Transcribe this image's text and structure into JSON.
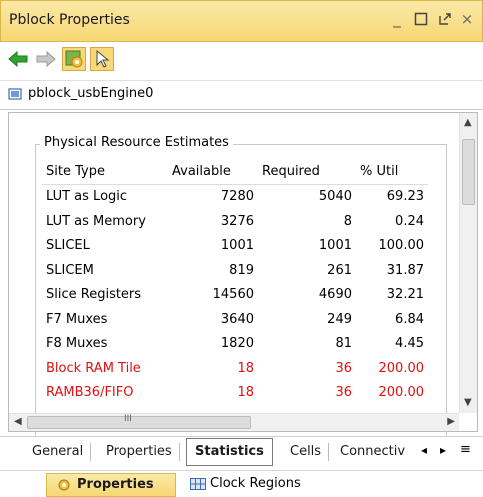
{
  "window": {
    "title": "Pblock Properties",
    "controls": {
      "minimize": "_",
      "maximize": "□",
      "float": "⇱",
      "close": "×"
    }
  },
  "toolbar": {
    "back_icon": "back-arrow-icon",
    "forward_icon": "forward-arrow-icon",
    "settings_icon": "auto-update-icon",
    "select_icon": "pointer-icon"
  },
  "object": {
    "name": "pblock_usbEngine0"
  },
  "section": {
    "title": "Physical Resource Estimates",
    "columns": [
      "Site Type",
      "Available",
      "Required",
      "% Util"
    ],
    "rows": [
      {
        "site": "LUT as Logic",
        "available": "7280",
        "required": "5040",
        "util": "69.23",
        "warn": false
      },
      {
        "site": "LUT as Memory",
        "available": "3276",
        "required": "8",
        "util": "0.24",
        "warn": false
      },
      {
        "site": "SLICEL",
        "available": "1001",
        "required": "1001",
        "util": "100.00",
        "warn": false
      },
      {
        "site": "SLICEM",
        "available": "819",
        "required": "261",
        "util": "31.87",
        "warn": false
      },
      {
        "site": "Slice Registers",
        "available": "14560",
        "required": "4690",
        "util": "32.21",
        "warn": false
      },
      {
        "site": "F7 Muxes",
        "available": "3640",
        "required": "249",
        "util": "6.84",
        "warn": false
      },
      {
        "site": "F8 Muxes",
        "available": "1820",
        "required": "81",
        "util": "4.45",
        "warn": false
      },
      {
        "site": "Block RAM Tile",
        "available": "18",
        "required": "36",
        "util": "200.00",
        "warn": true
      },
      {
        "site": "RAMB36/FIFO",
        "available": "18",
        "required": "36",
        "util": "200.00",
        "warn": true
      }
    ],
    "warn_color": "#e01010"
  },
  "scroll": {
    "hthumb_glyph": "III"
  },
  "tabs": [
    {
      "label": "General"
    },
    {
      "label": "Properties"
    },
    {
      "label": "Statistics",
      "selected": true
    },
    {
      "label": "Cells"
    },
    {
      "label": "Connectiv"
    }
  ],
  "tab_nav": {
    "prev": "◂",
    "next": "▸",
    "menu": "≡"
  },
  "bottom_tabs": [
    {
      "label": "Properties",
      "selected": true
    },
    {
      "label": "Clock Regions",
      "selected": false
    }
  ],
  "colors": {
    "title_bar": "#f7d774",
    "accent": "#d8b84a"
  }
}
